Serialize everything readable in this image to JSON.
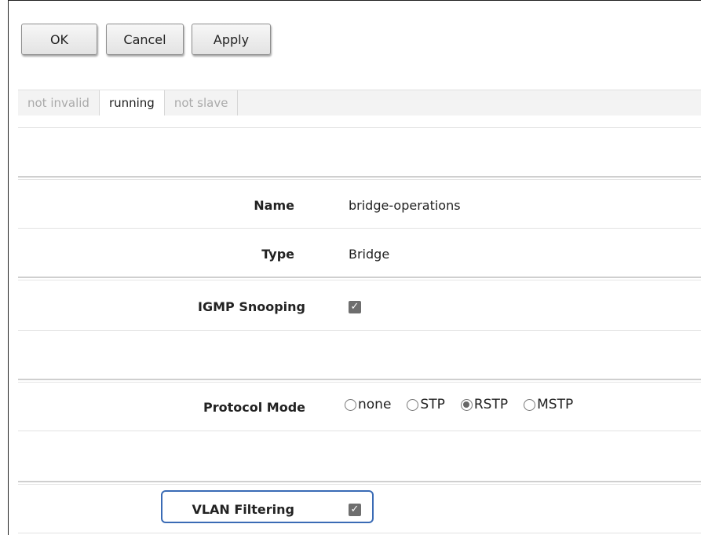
{
  "toolbar": {
    "ok_label": "OK",
    "cancel_label": "Cancel",
    "apply_label": "Apply"
  },
  "status_tabs": [
    {
      "label": "not invalid",
      "active": false
    },
    {
      "label": "running",
      "active": true
    },
    {
      "label": "not slave",
      "active": false
    }
  ],
  "form": {
    "name": {
      "label": "Name",
      "value": "bridge-operations"
    },
    "type": {
      "label": "Type",
      "value": "Bridge"
    },
    "igmp_snooping": {
      "label": "IGMP Snooping",
      "checked": true
    },
    "protocol_mode": {
      "label": "Protocol Mode",
      "options": [
        "none",
        "STP",
        "RSTP",
        "MSTP"
      ],
      "selected": "RSTP"
    },
    "vlan_filtering": {
      "label": "VLAN Filtering",
      "checked": true
    }
  },
  "colors": {
    "highlight": "#3a6bb5",
    "checkbox": "#6e6e6e"
  }
}
